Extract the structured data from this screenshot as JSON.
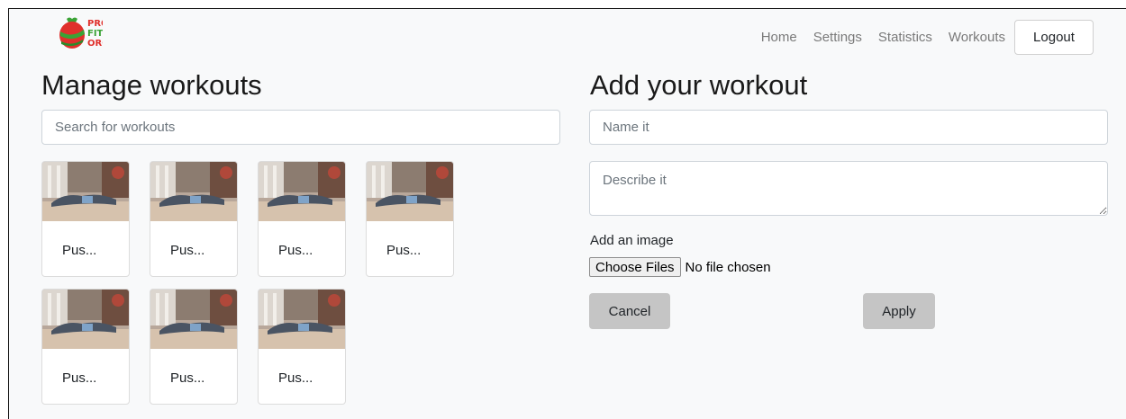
{
  "header": {
    "logo_text": [
      "PRO",
      "FIT",
      "ORO"
    ],
    "nav": [
      "Home",
      "Settings",
      "Statistics",
      "Workouts"
    ],
    "logout_label": "Logout"
  },
  "manage": {
    "title": "Manage workouts",
    "search_placeholder": "Search for workouts",
    "cards": [
      {
        "title": "Pus..."
      },
      {
        "title": "Pus..."
      },
      {
        "title": "Pus..."
      },
      {
        "title": "Pus..."
      },
      {
        "title": "Pus..."
      },
      {
        "title": "Pus..."
      },
      {
        "title": "Pus..."
      }
    ]
  },
  "add": {
    "title": "Add your workout",
    "name_placeholder": "Name it",
    "describe_placeholder": "Describe it",
    "image_label": "Add an image",
    "file_button": "Choose Files",
    "file_status": "No file chosen",
    "cancel_label": "Cancel",
    "apply_label": "Apply"
  },
  "colors": {
    "page_bg": "#f8f9fa",
    "button_gray": "#c5c5c5",
    "logo_red": "#e0302c",
    "logo_green": "#3aa335"
  }
}
